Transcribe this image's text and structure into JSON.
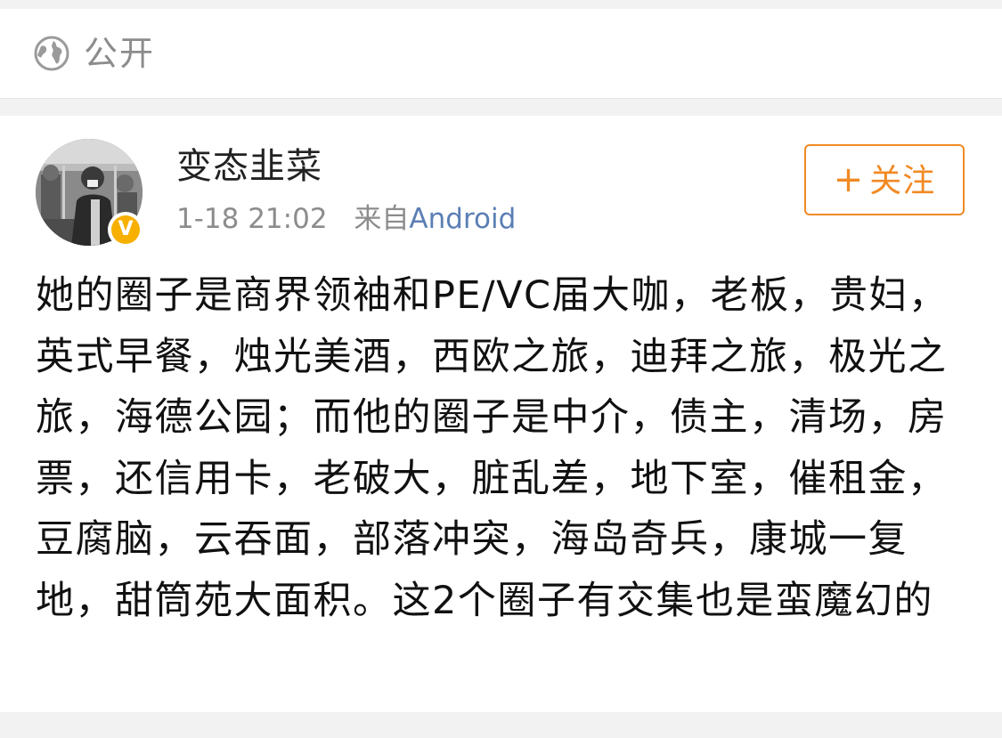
{
  "visibility": {
    "icon": "globe-icon",
    "label": "公开"
  },
  "post": {
    "author": {
      "name": "变态韭菜",
      "avatar": "avatar-photo",
      "verified_badge": "V",
      "verified_color": "#f7b000"
    },
    "timestamp": "1-18 21:02",
    "source_prefix": "来自",
    "source_name": "Android",
    "follow_button": {
      "plus": "+",
      "label": "关注",
      "color": "#f08a24"
    },
    "text": "她的圈子是商界领袖和PE/VC届大咖，老板，贵妇，英式早餐，烛光美酒，西欧之旅，迪拜之旅，极光之旅，海德公园；而他的圈子是中介，债主，清场，房票，还信用卡，老破大，脏乱差，地下室，催租金，豆腐脑，云吞面，部落冲突，海岛奇兵，康城一复地，甜筒苑大面积。这2个圈子有交集也是蛮魔幻的"
  }
}
